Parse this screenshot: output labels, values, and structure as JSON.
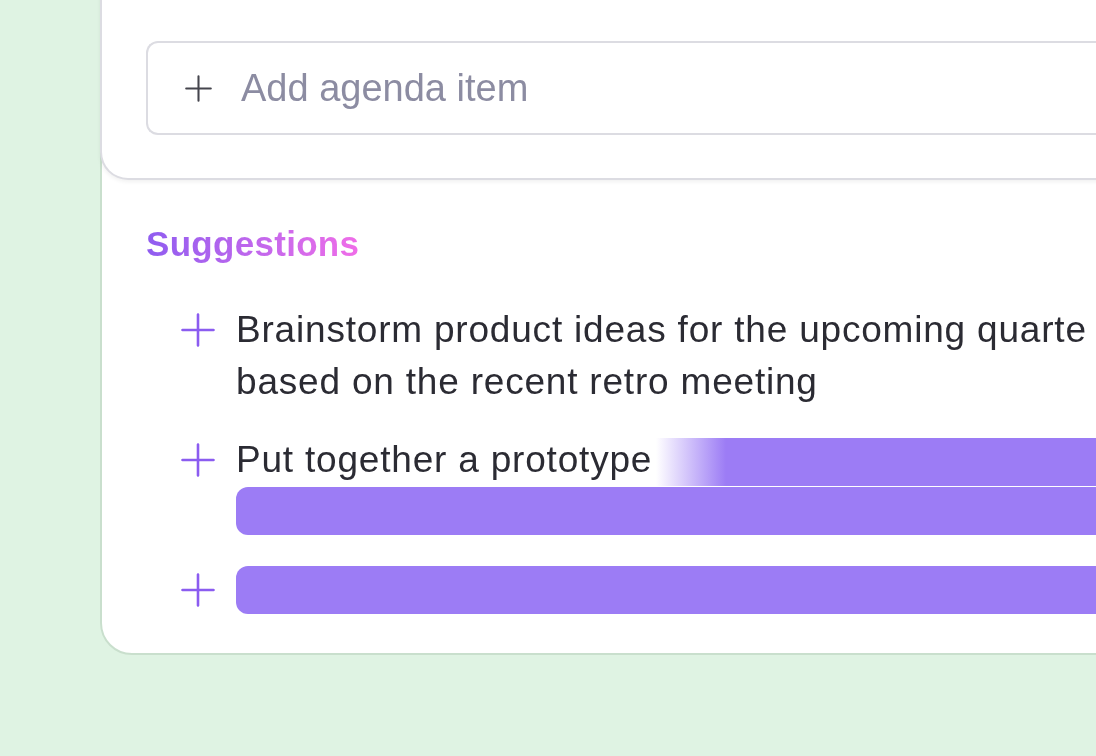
{
  "agenda_input": {
    "placeholder": "Add agenda item"
  },
  "suggestions": {
    "title": "Suggestions",
    "items": [
      {
        "kind": "text",
        "lines": [
          "Brainstorm product ideas for the upcoming quarte",
          "based on the recent retro meeting"
        ]
      },
      {
        "kind": "streaming",
        "lines": [
          "Put together a prototype"
        ]
      },
      {
        "kind": "placeholder"
      }
    ]
  }
}
